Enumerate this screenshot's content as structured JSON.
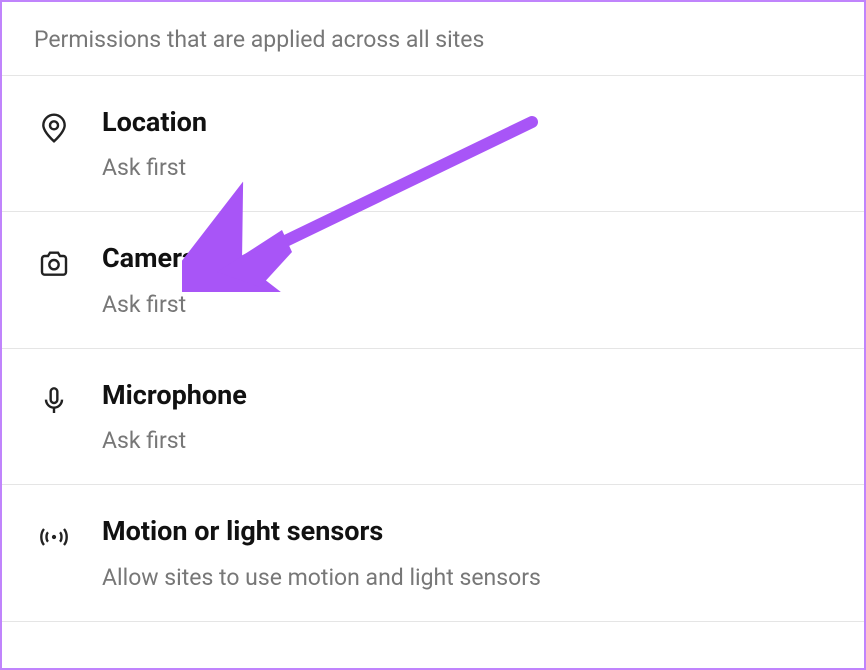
{
  "header": {
    "text": "Permissions that are applied across all sites"
  },
  "permissions": [
    {
      "title": "Location",
      "subtitle": "Ask first"
    },
    {
      "title": "Camera",
      "subtitle": "Ask first"
    },
    {
      "title": "Microphone",
      "subtitle": "Ask first"
    },
    {
      "title": "Motion or light sensors",
      "subtitle": "Allow sites to use motion and light sensors"
    }
  ]
}
